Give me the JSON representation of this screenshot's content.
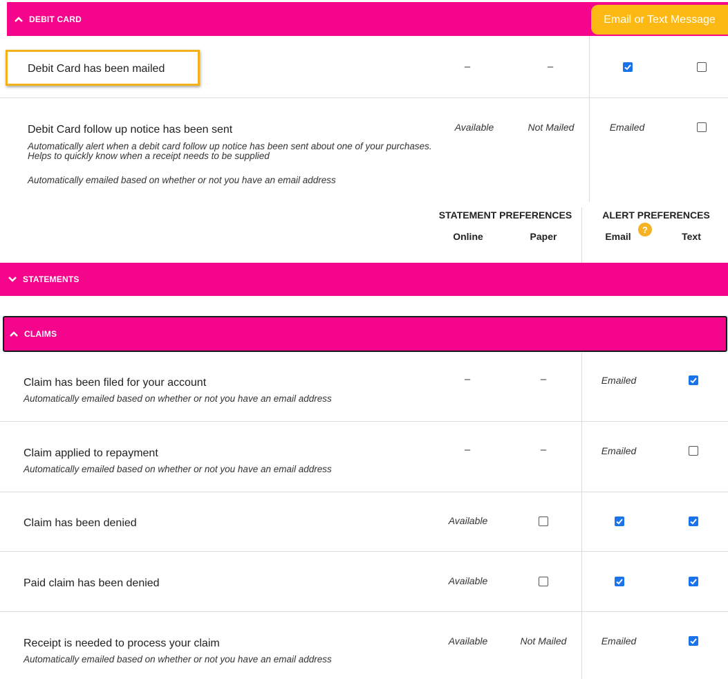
{
  "debit_section": {
    "bar_label": "DEBIT CARD",
    "tooltip_pill": "Email or Text Message",
    "rows": [
      {
        "title": "Debit Card has been mailed",
        "online": "–",
        "paper": "–",
        "email_checked": true,
        "text_checked": false
      },
      {
        "title": "Debit Card follow up notice has been sent",
        "desc": "Automatically alert when a debit card follow up notice has been sent about one of your purchases. Helps to quickly know when a receipt needs to be supplied",
        "note": "Automatically emailed based on whether or not you have an email address",
        "online": "Available",
        "paper": "Not Mailed",
        "email": "Emailed",
        "text_checked": false
      }
    ]
  },
  "preferences_header": {
    "statement": "STATEMENT PREFERENCES",
    "alert": "ALERT PREFERENCES",
    "online": "Online",
    "paper": "Paper",
    "email": "Email",
    "text": "Text",
    "help": "?"
  },
  "statements_section": {
    "bar_label": "STATEMENTS"
  },
  "claims_section": {
    "bar_label": "CLAIMS",
    "rows": [
      {
        "title": "Claim has been filed for your account",
        "desc": "Automatically emailed based on whether or not you have an email address",
        "online": "–",
        "paper": "–",
        "email": "Emailed",
        "text_checked": true
      },
      {
        "title": "Claim applied to repayment",
        "desc": "Automatically emailed based on whether or not you have an email address",
        "online": "–",
        "paper": "–",
        "email": "Emailed",
        "text_checked": false
      },
      {
        "title": "Claim has been denied",
        "online": "Available",
        "paper_checked": false,
        "email_checked": true,
        "text_checked": true
      },
      {
        "title": "Paid claim has been denied",
        "online": "Available",
        "paper_checked": false,
        "email_checked": true,
        "text_checked": true
      },
      {
        "title": "Receipt is needed to process your claim",
        "desc": "Automatically emailed based on whether or not you have an email address",
        "online": "Available",
        "paper": "Not Mailed",
        "email": "Emailed",
        "text_checked": true
      }
    ]
  },
  "colors": {
    "accent": "#f5058c",
    "pill": "#fdb913",
    "highlight": "#f2b118",
    "checkbox": "#1a73e8"
  }
}
